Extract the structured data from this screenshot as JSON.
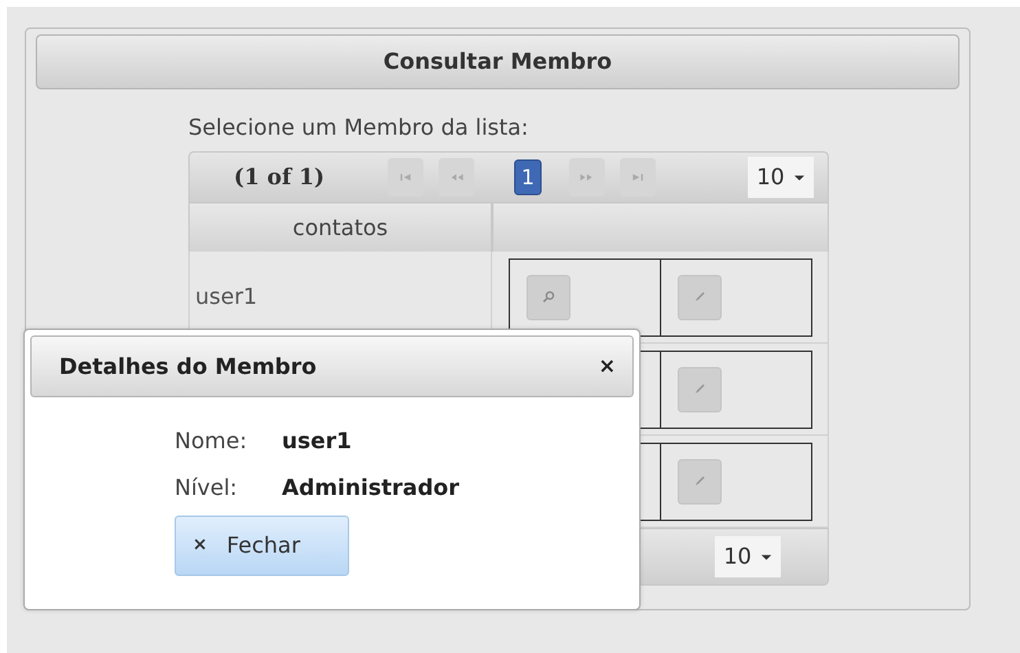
{
  "panel": {
    "title": "Consultar Membro",
    "prompt": "Selecione um Membro da lista:"
  },
  "paginator": {
    "report": "(1 of 1)",
    "pages": [
      {
        "label": "1",
        "selected": true
      }
    ],
    "rows_per_page": "10"
  },
  "table": {
    "columns": [
      "contatos"
    ],
    "rows": [
      {
        "contact": "user1"
      },
      {},
      {}
    ]
  },
  "bottom_paginator": {
    "rows_per_page": "10"
  },
  "dialog": {
    "title": "Detalhes do Membro",
    "close": "×",
    "fields": [
      {
        "label": "Nome:",
        "value": "user1"
      },
      {
        "label": "Nível:",
        "value": "Administrador"
      }
    ],
    "button": {
      "icon": "×",
      "label": "Fechar"
    }
  }
}
